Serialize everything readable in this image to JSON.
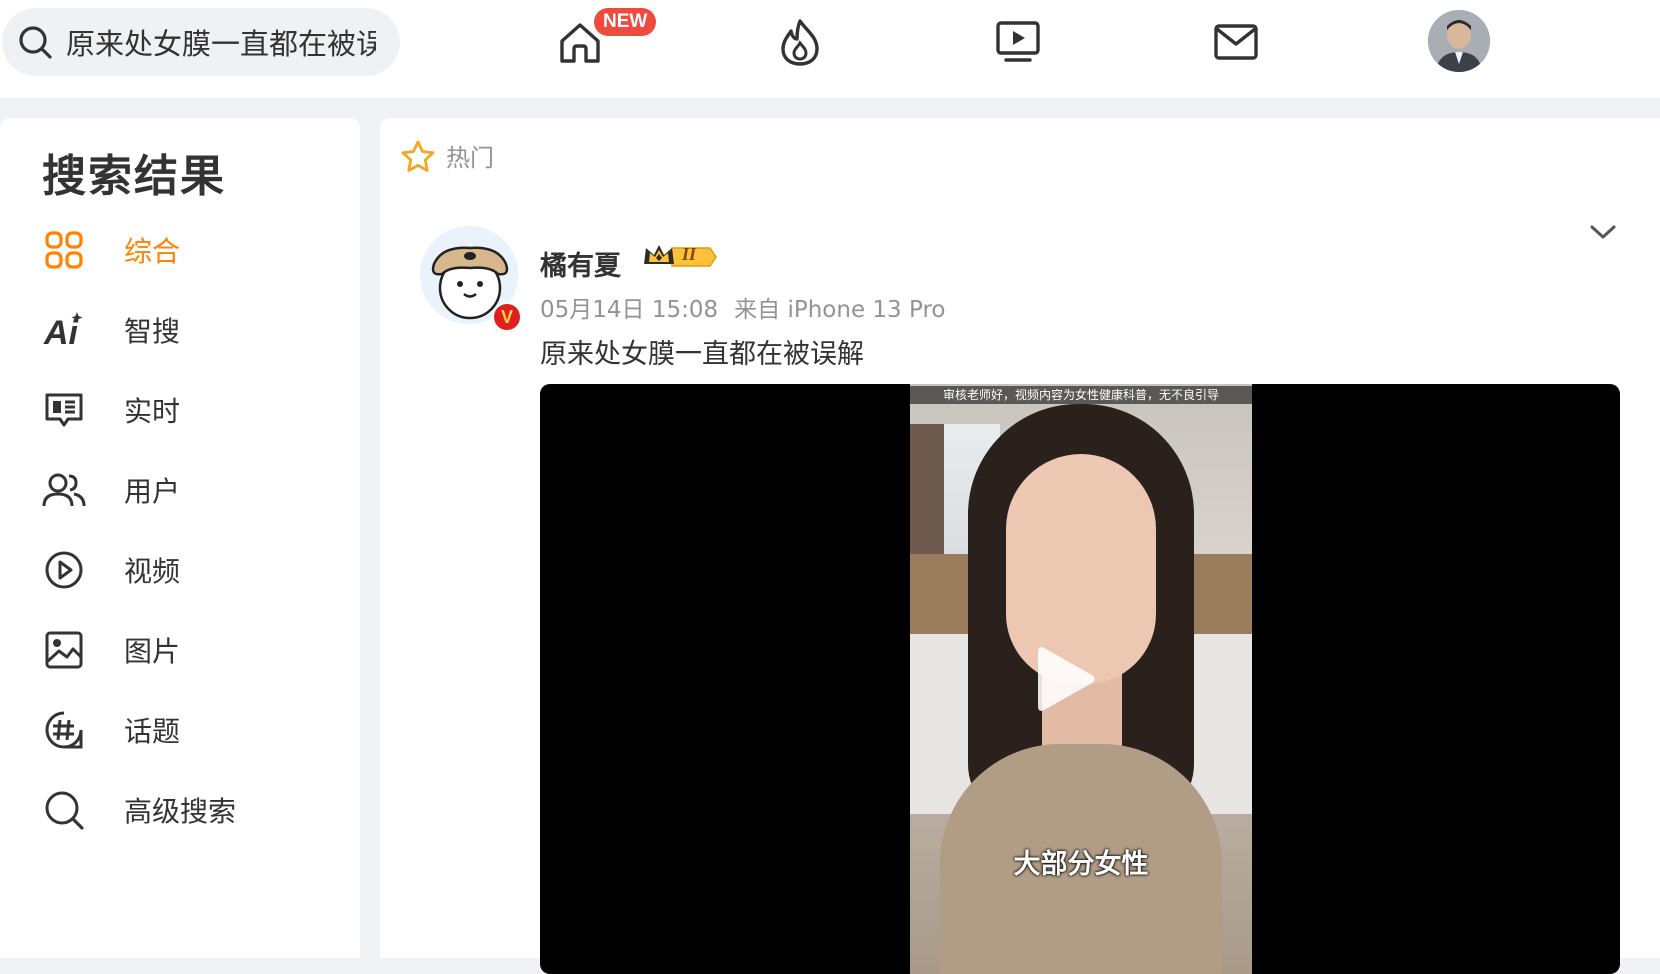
{
  "search": {
    "value": "原来处女膜一直都在被误解"
  },
  "nav": {
    "new_badge": "NEW",
    "icons": [
      "home-icon",
      "hot-icon",
      "video-icon",
      "message-icon"
    ]
  },
  "sidebar": {
    "title": "搜索结果",
    "items": [
      {
        "label": "综合",
        "icon": "grid-icon",
        "active": true
      },
      {
        "label": "智搜",
        "icon": "ai-icon"
      },
      {
        "label": "实时",
        "icon": "realtime-icon"
      },
      {
        "label": "用户",
        "icon": "users-icon"
      },
      {
        "label": "视频",
        "icon": "video-play-icon"
      },
      {
        "label": "图片",
        "icon": "image-icon"
      },
      {
        "label": "话题",
        "icon": "hashtag-icon"
      },
      {
        "label": "高级搜索",
        "icon": "search-icon"
      }
    ]
  },
  "main": {
    "hot_label": "热门",
    "post": {
      "user": "橘有夏",
      "verified_mark": "V",
      "level_badge": "II",
      "time": "05月14日 15:08",
      "source": "来自 iPhone 13 Pro",
      "text": "原来处女膜一直都在被误解",
      "video": {
        "top_caption": "审核老师好，视频内容为女性健康科普，无不良引导",
        "subtitle": "大部分女性"
      }
    }
  },
  "colors": {
    "accent": "#ff8200",
    "badge_red": "#f04a3e",
    "muted": "#939393"
  }
}
